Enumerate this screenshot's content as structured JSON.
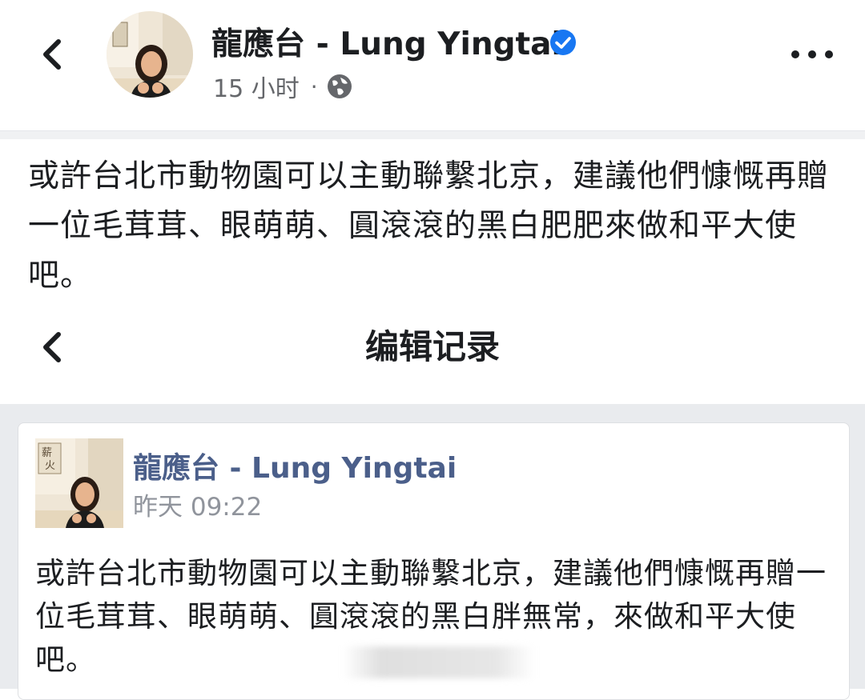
{
  "post": {
    "author": "龍應台 - Lung Yingtai",
    "time": "15 小时",
    "separator": "·",
    "text": "或許台北市動物園可以主動聯繫北京，建議他們慷慨再贈一位毛茸茸、眼萌萌、圓滾滾的黑白肥肥來做和平大使吧。"
  },
  "edit_history": {
    "title": "编辑记录",
    "entry": {
      "author": "龍應台 - Lung Yingtai",
      "time": "昨天 09:22",
      "text": "或許台北市動物園可以主動聯繫北京，建議他們慷慨再贈一位毛茸茸、眼萌萌、圓滾滾的黑白胖無常，來做和平大使吧。"
    }
  },
  "colors": {
    "verified": "#1877f2",
    "name_link": "#4b5f8a",
    "secondary_text": "#65676b",
    "section_bg": "#e9ebee"
  },
  "icons": [
    "back-chevron-icon",
    "verified-badge-icon",
    "globe-icon",
    "more-options-icon"
  ]
}
